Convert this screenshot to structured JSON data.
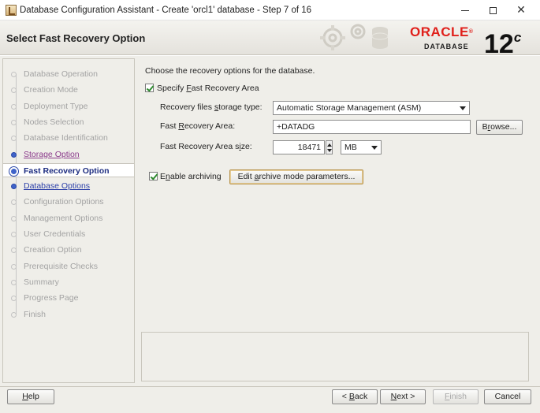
{
  "window": {
    "title": "Database Configuration Assistant - Create 'orcl1' database - Step 7 of 16"
  },
  "header": {
    "title": "Select Fast Recovery Option",
    "logo_brand": "ORACLE",
    "logo_product": "DATABASE",
    "logo_version": "12",
    "logo_version_suffix": "c"
  },
  "steps": [
    {
      "label": "Database Operation",
      "state": "disabled"
    },
    {
      "label": "Creation Mode",
      "state": "disabled"
    },
    {
      "label": "Deployment Type",
      "state": "disabled"
    },
    {
      "label": "Nodes Selection",
      "state": "disabled"
    },
    {
      "label": "Database Identification",
      "state": "disabled"
    },
    {
      "label": "Storage Option",
      "state": "visited"
    },
    {
      "label": "Fast Recovery Option",
      "state": "current"
    },
    {
      "label": "Database Options",
      "state": "link"
    },
    {
      "label": "Configuration Options",
      "state": "disabled"
    },
    {
      "label": "Management Options",
      "state": "disabled"
    },
    {
      "label": "User Credentials",
      "state": "disabled"
    },
    {
      "label": "Creation Option",
      "state": "disabled"
    },
    {
      "label": "Prerequisite Checks",
      "state": "disabled"
    },
    {
      "label": "Summary",
      "state": "disabled"
    },
    {
      "label": "Progress Page",
      "state": "disabled"
    },
    {
      "label": "Finish",
      "state": "disabled"
    }
  ],
  "form": {
    "intro": "Choose the recovery options for the database.",
    "specify_fra_label": "Specify Fast Recovery Area",
    "specify_fra_checked": true,
    "storage_type_label": "Recovery files storage type:",
    "storage_type_value": "Automatic Storage Management (ASM)",
    "fra_label": "Fast Recovery Area:",
    "fra_value": "+DATADG",
    "browse_label": "Browse...",
    "fra_size_label": "Fast Recovery Area size:",
    "fra_size_value": "18471",
    "fra_size_unit": "MB",
    "archiving_label": "Enable archiving",
    "archiving_checked": true,
    "edit_archive_label": "Edit archive mode parameters..."
  },
  "footer": {
    "help": "Help",
    "back": "< Back",
    "next": "Next >",
    "finish": "Finish",
    "cancel": "Cancel"
  }
}
